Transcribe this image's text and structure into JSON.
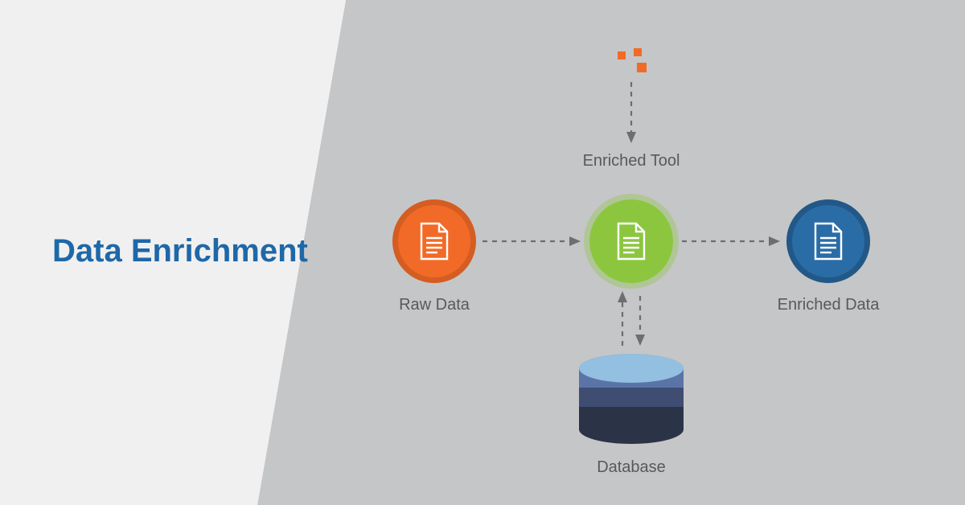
{
  "title": "Data Enrichment",
  "nodes": {
    "raw": {
      "label": "Raw Data",
      "color": "#f26a27"
    },
    "tool": {
      "label": "Enriched Tool",
      "color": "#8cc63f"
    },
    "enriched": {
      "label": "Enriched Data",
      "color": "#2a6ca6"
    },
    "database": {
      "label": "Database"
    }
  },
  "icons": {
    "doc": "document-icon",
    "db": "database-icon",
    "dots": "particles-icon"
  },
  "flows": [
    "raw -> tool",
    "tool -> enriched",
    "particles -> tool",
    "tool <-> database"
  ]
}
